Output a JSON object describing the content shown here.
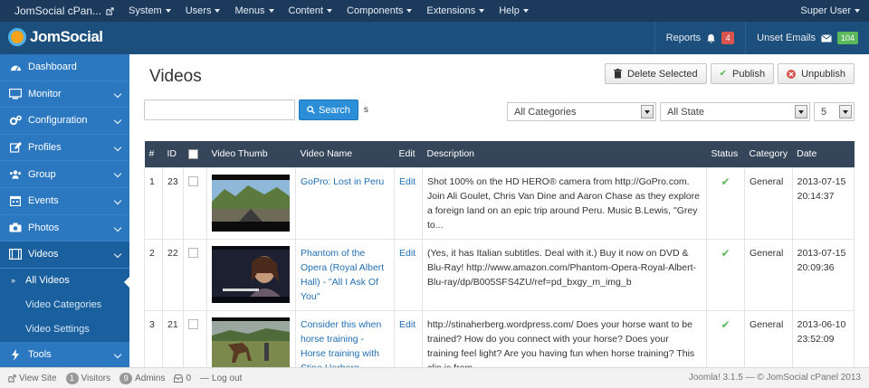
{
  "topbar": {
    "brand": "JomSocial cPan...",
    "menu": [
      {
        "label": "System"
      },
      {
        "label": "Users"
      },
      {
        "label": "Menus"
      },
      {
        "label": "Content"
      },
      {
        "label": "Components"
      },
      {
        "label": "Extensions"
      },
      {
        "label": "Help"
      }
    ],
    "user": "Super User"
  },
  "header": {
    "logo": "JomSocial",
    "reports_label": "Reports",
    "reports_count": "4",
    "unset_emails_label": "Unset Emails",
    "unset_emails_count": "104"
  },
  "sidebar": {
    "items": [
      {
        "label": "Dashboard",
        "icon": "dashboard-icon"
      },
      {
        "label": "Monitor",
        "icon": "monitor-icon"
      },
      {
        "label": "Configuration",
        "icon": "gears-icon"
      },
      {
        "label": "Profiles",
        "icon": "edit-icon"
      },
      {
        "label": "Group",
        "icon": "users-icon"
      },
      {
        "label": "Events",
        "icon": "calendar-icon"
      },
      {
        "label": "Photos",
        "icon": "camera-icon"
      },
      {
        "label": "Videos",
        "icon": "film-icon"
      }
    ],
    "sub": [
      {
        "label": "All Videos",
        "marker": "»"
      },
      {
        "label": "Video Categories"
      },
      {
        "label": "Video Settings"
      }
    ],
    "tools": "Tools"
  },
  "main": {
    "title": "Videos",
    "toolbar": {
      "delete": "Delete Selected",
      "publish": "Publish",
      "unpublish": "Unpublish"
    },
    "search": {
      "value": "",
      "button": "Search",
      "suffix": "s"
    },
    "filters": {
      "category": "All Categories",
      "state": "All State",
      "limit": "5"
    },
    "table": {
      "headers": [
        "#",
        "ID",
        "",
        "Video Thumb",
        "Video Name",
        "Edit",
        "Description",
        "Status",
        "Category",
        "Date"
      ],
      "rows": [
        {
          "num": "1",
          "id": "23",
          "name": "GoPro: Lost in Peru",
          "edit": "Edit",
          "description": "Shot 100% on the HD HERO® camera from http://GoPro.com. Join Ali Goulet, Chris Van Dine and Aaron Chase as they explore a foreign land on an epic trip around Peru. Music B.Lewis, \"Grey to...",
          "category": "General",
          "date": "2013-07-15 20:14:37"
        },
        {
          "num": "2",
          "id": "22",
          "name": "Phantom of the Opera (Royal Albert Hall) - \"All I Ask Of You\"",
          "edit": "Edit",
          "description": "(Yes, it has Italian subtitles. Deal with it.) Buy it now on DVD & Blu-Ray! http://www.amazon.com/Phantom-Opera-Royal-Albert-Blu-ray/dp/B005SFS4ZU/ref=pd_bxgy_m_img_b",
          "category": "General",
          "date": "2013-07-15 20:09:36"
        },
        {
          "num": "3",
          "id": "21",
          "name": "Consider this when horse training - Horse training with Stina Herberg",
          "edit": "Edit",
          "description": "http://stinaherberg.wordpress.com/ Does your horse want to be trained? How do you connect with your horse? Does your training feel light? Are you having fun when horse training? This clip is from...",
          "category": "General",
          "date": "2013-06-10 23:52:09"
        }
      ]
    }
  },
  "footer": {
    "view_site": "View Site",
    "visitors_count": "1",
    "visitors_label": "Visitors",
    "admins_count": "9",
    "admins_label": "Admins",
    "messages_count": "0",
    "logout": "Log out",
    "version": "Joomla! 3.1.5 — © JomSocial cPanel 2013"
  },
  "colors": {
    "topbar": "#1b3a5c",
    "header": "#1d4f7c",
    "sidebar": "#2b78c0",
    "table_header": "#36465a",
    "accent": "#2d8ed8",
    "success": "#5cb85c",
    "danger": "#d9534f"
  }
}
